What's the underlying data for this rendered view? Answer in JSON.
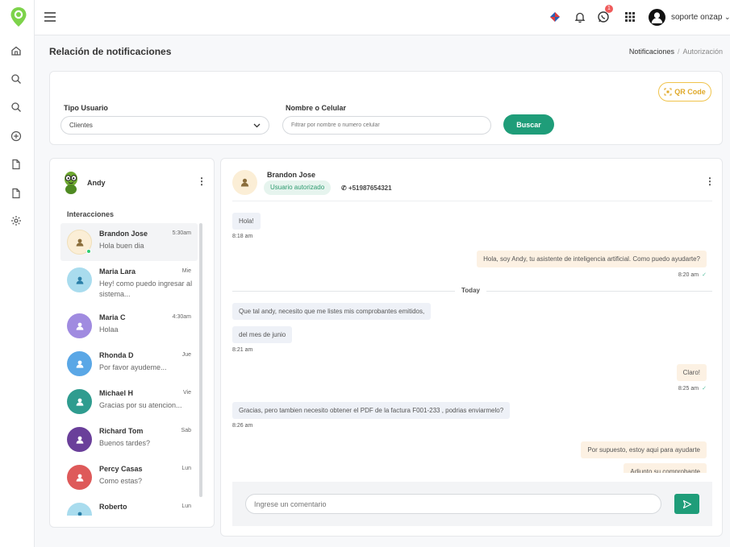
{
  "topbar": {
    "user_name": "soporte onzap",
    "notification_badge": "1",
    "icons": [
      "menu-icon",
      "flag-icon",
      "bell-icon",
      "whatsapp-icon",
      "apps-grid-icon",
      "user-avatar",
      "chevron-down-icon"
    ]
  },
  "sidebar": {
    "icons": [
      "logo-pin-icon",
      "home-icon",
      "search-icon",
      "search-icon",
      "add-circle-icon",
      "document-icon",
      "document-icon",
      "settings-icon"
    ]
  },
  "page": {
    "title": "Relación de notificaciones",
    "breadcrumb": [
      "Notificaciones",
      "Autorización"
    ]
  },
  "filters": {
    "qr_label": "QR Code",
    "tipo_label": "Tipo Usuario",
    "tipo_value": "Clientes",
    "nombre_label": "Nombre o Celular",
    "nombre_placeholder": "Filtrar por nombre o numero celular",
    "search_button": "Buscar"
  },
  "agent": {
    "name": "Andy"
  },
  "interactions": {
    "title": "Interacciones",
    "items": [
      {
        "name": "Brandon Jose",
        "time": "5:30am",
        "preview": "Hola buen dia",
        "color": "#fbeed6",
        "icon_color": "#8a6d3b",
        "active": true
      },
      {
        "name": "Maria Lara",
        "time": "Mie",
        "preview": "Hey! como puedo ingresar al sistema...",
        "color": "#a9dcee",
        "icon_color": "#2a7fa8"
      },
      {
        "name": "Maria C",
        "time": "4:30am",
        "preview": "Holaa",
        "color": "#a08be0",
        "icon_color": "#fff"
      },
      {
        "name": "Rhonda D",
        "time": "Jue",
        "preview": "Por favor ayudeme...",
        "color": "#5aa7e6",
        "icon_color": "#fff"
      },
      {
        "name": "Michael H",
        "time": "Vie",
        "preview": "Gracias por su atencion...",
        "color": "#2f9c8f",
        "icon_color": "#fff"
      },
      {
        "name": "Richard Tom",
        "time": "Sab",
        "preview": "Buenos tardes?",
        "color": "#6a3f9a",
        "icon_color": "#fff"
      },
      {
        "name": "Percy Casas",
        "time": "Lun",
        "preview": "Como estas?",
        "color": "#de5a5a",
        "icon_color": "#fff"
      },
      {
        "name": "Roberto",
        "time": "Lun",
        "preview": "",
        "color": "#a9dcee",
        "icon_color": "#2a7fa8"
      }
    ]
  },
  "chat": {
    "contact_name": "Brandon Jose",
    "status_tag": "Usuario autorizado",
    "phone": "+51987654321",
    "today_label": "Today",
    "messages": [
      {
        "dir": "in",
        "text": "Hola!",
        "time": "8:18 am"
      },
      {
        "dir": "out",
        "text": "Hola, soy Andy, tu asistente de inteligencia artificial. Como puedo ayudarte?",
        "time": "8:20 am"
      },
      {
        "dir": "in",
        "text": "Que tal andy, necesito que me listes mis comprobantes emitidos,",
        "time": ""
      },
      {
        "dir": "in",
        "text": "del mes de junio",
        "time": "8:21 am"
      },
      {
        "dir": "out",
        "text": "Claro!",
        "time": "8:25 am"
      },
      {
        "dir": "in",
        "text": "Gracias, pero tambien necesito obtener el PDF de la factura F001-233 , podrias enviarmelo?",
        "time": "8:26 am"
      },
      {
        "dir": "out",
        "text": "Por supuesto, estoy aqui para ayudarte",
        "time": ""
      },
      {
        "dir": "out",
        "text": "Adjunto su comprobante",
        "time": ""
      }
    ],
    "composer_placeholder": "Ingrese un comentario"
  }
}
